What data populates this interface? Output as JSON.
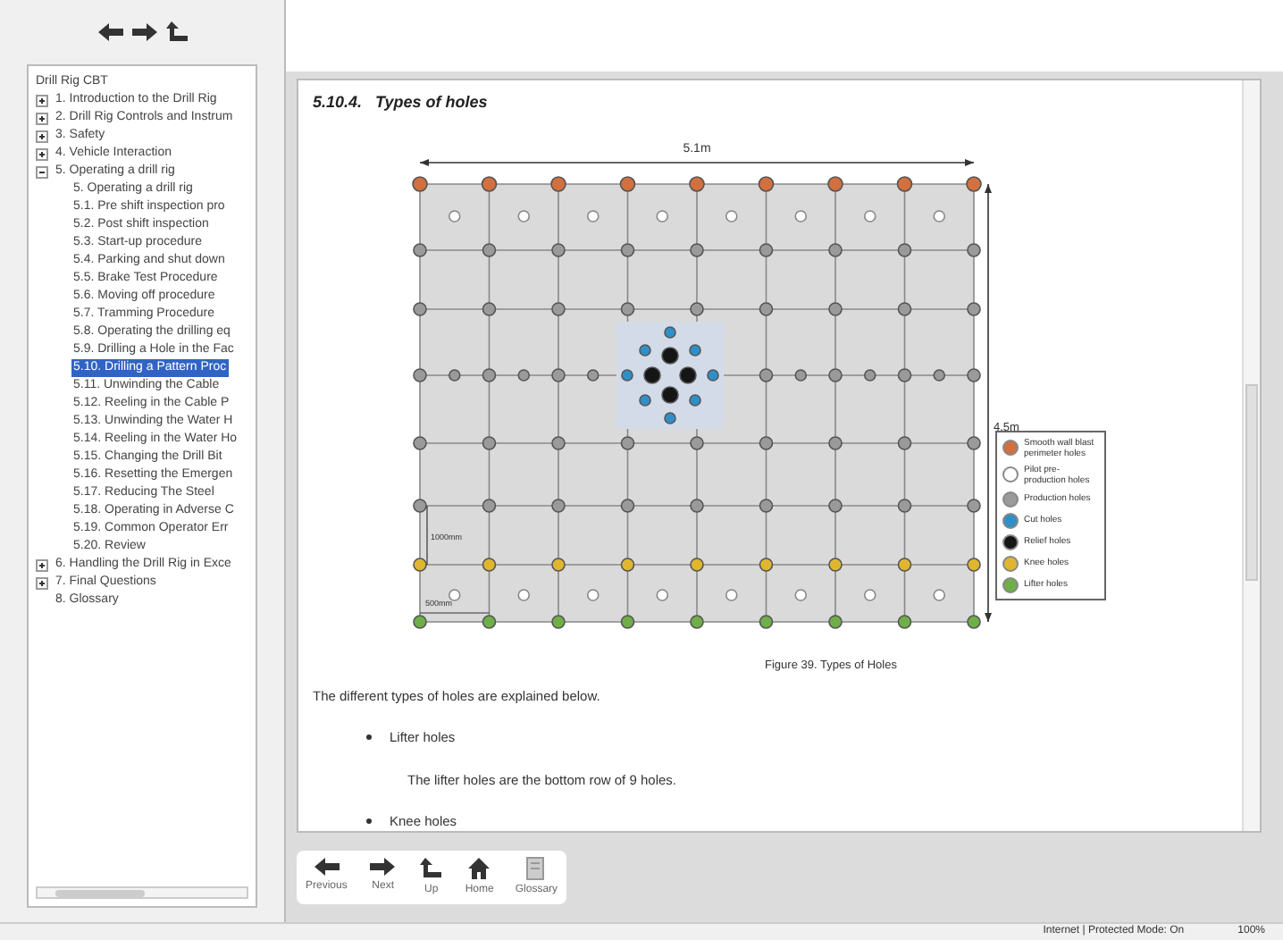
{
  "tree": {
    "root": "Drill Rig CBT",
    "items": [
      {
        "label": "1. Introduction to the Drill Rig",
        "expanded": false,
        "selected": false
      },
      {
        "label": "2. Drill Rig Controls and Instrum",
        "expanded": false,
        "selected": false
      },
      {
        "label": "3. Safety",
        "expanded": false,
        "selected": false
      },
      {
        "label": "4. Vehicle Interaction",
        "expanded": false,
        "selected": false
      },
      {
        "label": "5. Operating a drill rig",
        "expanded": true,
        "selected": false,
        "children": [
          {
            "label": "5. Operating a drill rig",
            "selected": false
          },
          {
            "label": "5.1. Pre shift inspection pro",
            "selected": false
          },
          {
            "label": "5.2. Post shift inspection",
            "selected": false
          },
          {
            "label": "5.3. Start-up procedure",
            "selected": false
          },
          {
            "label": "5.4. Parking and shut down",
            "selected": false
          },
          {
            "label": "5.5. Brake Test Procedure",
            "selected": false
          },
          {
            "label": "5.6. Moving off procedure",
            "selected": false
          },
          {
            "label": "5.7. Tramming Procedure",
            "selected": false
          },
          {
            "label": "5.8. Operating the drilling eq",
            "selected": false
          },
          {
            "label": "5.9. Drilling a Hole in the Fac",
            "selected": false
          },
          {
            "label": "5.10. Drilling a Pattern Proc",
            "selected": true
          },
          {
            "label": "5.11. Unwinding the Cable",
            "selected": false
          },
          {
            "label": "5.12. Reeling in the Cable P",
            "selected": false
          },
          {
            "label": "5.13. Unwinding the Water H",
            "selected": false
          },
          {
            "label": "5.14. Reeling in the Water Ho",
            "selected": false
          },
          {
            "label": "5.15. Changing the Drill Bit",
            "selected": false
          },
          {
            "label": "5.16. Resetting the Emergen",
            "selected": false
          },
          {
            "label": "5.17. Reducing The Steel",
            "selected": false
          },
          {
            "label": "5.18. Operating in Adverse C",
            "selected": false
          },
          {
            "label": "5.19. Common Operator Err",
            "selected": false
          },
          {
            "label": "5.20. Review",
            "selected": false
          }
        ]
      },
      {
        "label": "6. Handling the Drill Rig in Exce",
        "expanded": false,
        "selected": false
      },
      {
        "label": "7. Final Questions",
        "expanded": false,
        "selected": false
      },
      {
        "label": "8. Glossary",
        "selected": false
      }
    ]
  },
  "heading": "5.10.4.   Types of holes",
  "figure": {
    "width_label": "5.1m",
    "height_label": "4.5m",
    "spacing_label": "1000mm",
    "offset_label": "500mm",
    "legend": [
      {
        "label": "Smooth wall blast perimeter holes",
        "color": "#d2703f"
      },
      {
        "label": "Pilot pre-production holes",
        "color": "#ffffff"
      },
      {
        "label": "Production holes",
        "color": "#9a9a9a"
      },
      {
        "label": "Cut holes",
        "color": "#2f8fc8"
      },
      {
        "label": "Relief holes",
        "color": "#151515"
      },
      {
        "label": "Knee holes",
        "color": "#e0b630"
      },
      {
        "label": "Lifter holes",
        "color": "#6fae48"
      }
    ],
    "caption": "Figure 39. Types of Holes"
  },
  "intro": "The different types of holes are explained below.",
  "sections": [
    {
      "title": "Lifter holes",
      "text": "The lifter holes are the bottom row of 9 holes."
    },
    {
      "title": "Knee holes"
    }
  ],
  "toolbar": [
    "Previous",
    "Next",
    "Up",
    "Home",
    "Glossary"
  ],
  "status": {
    "zone": "Internet | Protected Mode: On",
    "zoom": "100%"
  }
}
